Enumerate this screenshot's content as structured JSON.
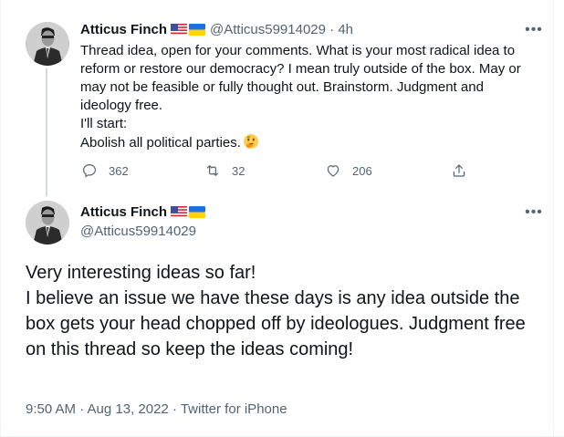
{
  "reply_tweet": {
    "author_name": "Atticus Finch",
    "handle": "@Atticus59914029",
    "separator": "·",
    "time_ago": "4h",
    "text": "Thread idea, open for your comments. What is your most radical idea to reform or restore our democracy? I mean truly outside of the box. May or may not be feasible or fully thought out. Brainstorm. Judgment and ideology free.\nI'll start:\nAbolish all political parties.",
    "emoji": "thinking-face-emoji",
    "more_icon": "more-dots-icon",
    "actions": {
      "reply_count": "362",
      "retweet_count": "32",
      "like_count": "206",
      "share_icon": "share-icon"
    }
  },
  "main_tweet": {
    "author_name": "Atticus Finch",
    "handle": "@Atticus59914029",
    "more_icon": "more-dots-icon",
    "text": "Very interesting ideas so far!\nI believe an issue we have these days is any idea outside the box gets your head chopped off by ideologues.  Judgment free on this thread so keep the ideas coming!",
    "timestamp": "9:50 AM · Aug 13, 2022 · Twitter for iPhone"
  },
  "colors": {
    "text_primary": "#0f1419",
    "text_secondary": "#536471",
    "thread_line": "#cfd9de",
    "divider": "#eff3f4"
  }
}
